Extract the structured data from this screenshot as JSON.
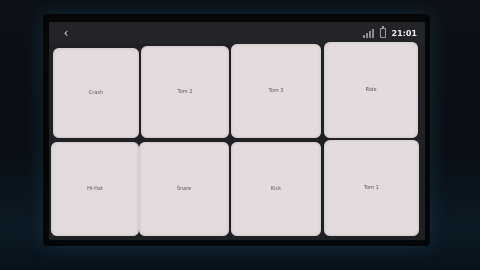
{
  "topbar": {
    "back_icon": "chevron-left-icon",
    "signal_icon": "signal-icon",
    "battery_icon": "battery-icon",
    "time": "21:01"
  },
  "pads": [
    {
      "label": "Crash"
    },
    {
      "label": "Tom 2"
    },
    {
      "label": "Tom 3"
    },
    {
      "label": "Ride"
    },
    {
      "label": "Hi-Hat"
    },
    {
      "label": "Snare"
    },
    {
      "label": "Kick"
    },
    {
      "label": "Tom 1"
    }
  ],
  "colors": {
    "pad": "#e4dbdd",
    "background": "#1e2024"
  }
}
